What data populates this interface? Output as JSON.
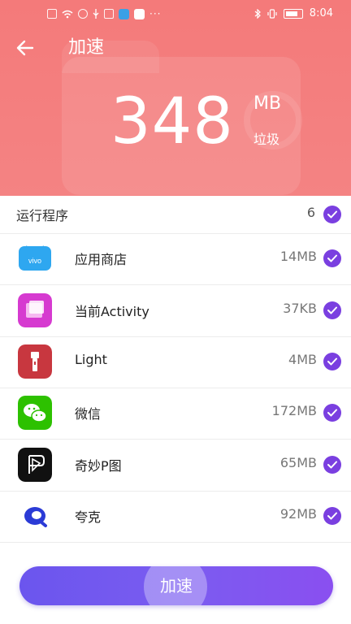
{
  "status_bar": {
    "icons_left": [
      "sim-icon",
      "wifi-icon",
      "cloud-icon",
      "usb-icon",
      "folder-icon",
      "app-notification-icon",
      "app-notification-icon-2"
    ],
    "more": "···",
    "icons_right": [
      "bluetooth-icon",
      "vibrate-icon",
      "battery-icon"
    ],
    "time": "8:04"
  },
  "header": {
    "back_icon": "arrow-left-icon",
    "title": "加速",
    "junk_size": "348",
    "junk_unit": "MB",
    "junk_label": "垃圾",
    "background_color": "#f47a7a"
  },
  "list_header": {
    "label": "运行程序",
    "count": "6"
  },
  "apps": [
    {
      "name": "应用商店",
      "size": "14MB",
      "icon": "app-store-icon",
      "checked": true
    },
    {
      "name": "当前Activity",
      "size": "37KB",
      "icon": "current-activity-icon",
      "checked": true
    },
    {
      "name": "Light",
      "size": "4MB",
      "icon": "flashlight-icon",
      "checked": true
    },
    {
      "name": "微信",
      "size": "172MB",
      "icon": "wechat-icon",
      "checked": true
    },
    {
      "name": "奇妙P图",
      "size": "65MB",
      "icon": "photo-editor-icon",
      "checked": true
    },
    {
      "name": "夸克",
      "size": "92MB",
      "icon": "quark-icon",
      "checked": true
    }
  ],
  "action_button": {
    "label": "加速"
  },
  "colors": {
    "accent_purple": "#7a3fe0",
    "button_gradient_start": "#6b55ee",
    "button_gradient_end": "#8a4ff0"
  }
}
